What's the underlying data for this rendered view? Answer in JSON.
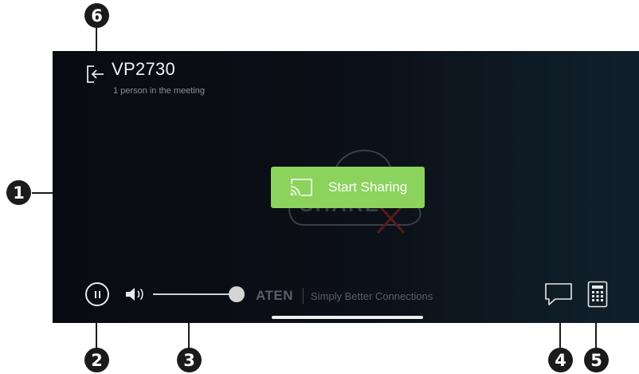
{
  "app": {
    "room_title": "VP2730",
    "participant_status": "1 person in the meeting",
    "share_button_label": "Start Sharing",
    "background_logo_text": "SHARE",
    "brand_logo": "ATEN",
    "brand_tagline": "Simply Better Connections",
    "volume_level": 1.0,
    "accent_color": "#8bd35c"
  },
  "callouts": [
    "1",
    "2",
    "3",
    "4",
    "5",
    "6"
  ],
  "icons": {
    "exit": "exit-arrow-icon",
    "cast": "cast-icon",
    "pause": "pause-icon",
    "speaker": "speaker-icon",
    "chat": "chat-icon",
    "keypad": "keypad-icon",
    "cloud": "cloud-offline-icon"
  }
}
